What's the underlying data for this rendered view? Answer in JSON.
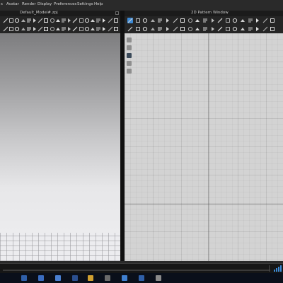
{
  "menubar": {
    "items": [
      "Avatar",
      "Render",
      "Display",
      "Preferences",
      "Settings",
      "Help"
    ],
    "leading_fragment": "s"
  },
  "left_panel": {
    "title": "Default_Model#.zpj"
  },
  "right_panel": {
    "title": "2D Pattern Window"
  },
  "colors": {
    "accent": "#3c8ad6",
    "toolbar_bg": "#252525",
    "pattern_bg": "#d3d3d3",
    "menubar_bg": "#2a2a2a"
  },
  "icons": {
    "left_toolbar_row1": [
      "select-icon",
      "move-icon",
      "pin-icon",
      "tack-icon",
      "fold-icon",
      "line-icon",
      "cut-icon",
      "sew-icon",
      "brush-icon",
      "sphere-icon",
      "arrange-icon",
      "button-icon",
      "zipper-icon",
      "trim-icon",
      "tape-icon",
      "puckering-icon",
      "measure-icon",
      "avatar-icon",
      "pose-icon",
      "hanger-icon"
    ],
    "left_toolbar_row2": [
      "transform-icon",
      "select-mesh-icon",
      "edit-icon",
      "point-icon",
      "steam-icon",
      "strengthen-icon",
      "shrink-icon",
      "fabric-icon",
      "texture-icon",
      "graphic-icon",
      "fold-arrange-icon",
      "reset-icon",
      "fit-icon",
      "size-icon",
      "grade-icon",
      "lock-icon",
      "freeze-icon",
      "layer-icon",
      "solidify-icon",
      "pin-remove-icon"
    ],
    "right_toolbar_row1": [
      "pattern-select-icon",
      "transform-pattern-icon",
      "edit-curve-icon",
      "add-point-icon",
      "polygon-icon",
      "rectangle-icon",
      "circle-icon",
      "internal-line-icon",
      "dart-icon",
      "notch-icon",
      "pleat-icon",
      "seam-allowance-icon",
      "sewing-icon",
      "free-sewing-icon",
      "tuck-icon",
      "zipper-pattern-icon",
      "elastic-icon",
      "grain-icon",
      "symmetry-icon",
      "trace-icon"
    ],
    "right_toolbar_row2": [
      "fold-line-icon",
      "slash-spread-icon",
      "offset-icon",
      "curvature-icon",
      "length-icon",
      "rotate-icon",
      "mirror-icon",
      "copy-icon",
      "paste-icon",
      "unfold-icon",
      "merge-icon",
      "split-icon",
      "align-icon",
      "distribute-icon",
      "ruler-icon",
      "annotate-icon",
      "symbol-icon",
      "grid-icon",
      "snap-icon",
      "settings-icon"
    ],
    "side_tools": [
      "pointer-icon",
      "cursor-icon",
      "zoom-icon",
      "frame-icon",
      "ruler-tool-icon"
    ],
    "taskbar": [
      "start-icon",
      "search-icon",
      "app-icon-1",
      "app-icon-2",
      "app-icon-3",
      "app-icon-4",
      "app-icon-5",
      "app-icon-6",
      "app-icon-7"
    ]
  }
}
